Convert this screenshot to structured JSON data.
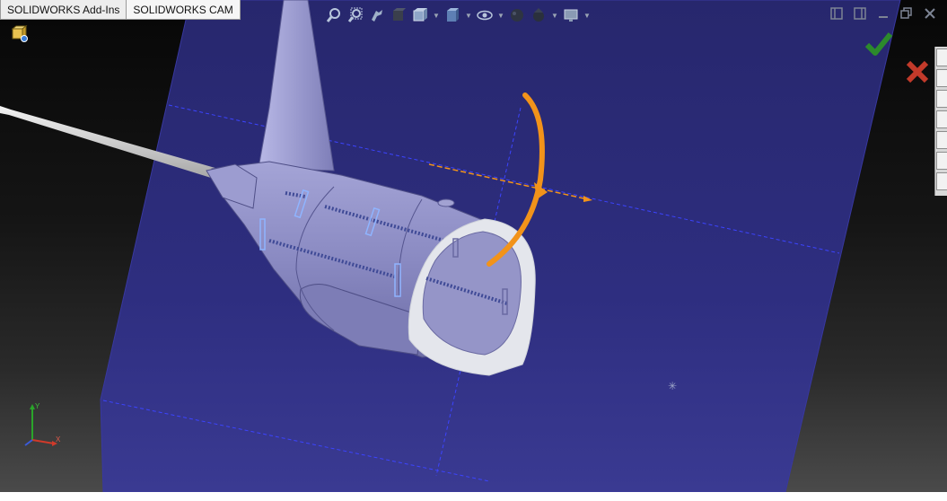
{
  "app": {
    "tabs": [
      {
        "label": "SOLIDWORKS Add-Ins"
      },
      {
        "label": "SOLIDWORKS CAM"
      }
    ],
    "tree_label": ""
  },
  "heads_up_toolbar": {
    "buttons": [
      {
        "icon": "zoom-to-fit-icon"
      },
      {
        "icon": "zoom-to-area-icon"
      },
      {
        "icon": "previous-view-icon"
      },
      {
        "icon": "section-view-icon"
      },
      {
        "icon": "view-orientation-icon"
      },
      {
        "icon": "display-style-icon"
      },
      {
        "icon": "hide-show-items-icon"
      },
      {
        "icon": "edit-appearance-icon"
      },
      {
        "icon": "apply-scene-icon"
      },
      {
        "icon": "view-settings-icon"
      }
    ]
  },
  "colors": {
    "plane": "#2a2a78",
    "fuselage": "#8c8cc2",
    "handle": "#f2931a",
    "background_top": "#070707",
    "accept": "#2c8a2c",
    "cancel": "#c23a2a"
  },
  "taskpane": {
    "buttons": [
      {
        "icon": "home-icon"
      },
      {
        "icon": "design-library-icon"
      },
      {
        "icon": "file-explorer-icon"
      },
      {
        "icon": "view-palette-icon"
      },
      {
        "icon": "appearances-icon"
      },
      {
        "icon": "custom-properties-icon"
      },
      {
        "icon": "forum-icon"
      }
    ]
  },
  "triad": {
    "x": "X",
    "y": "Y"
  }
}
